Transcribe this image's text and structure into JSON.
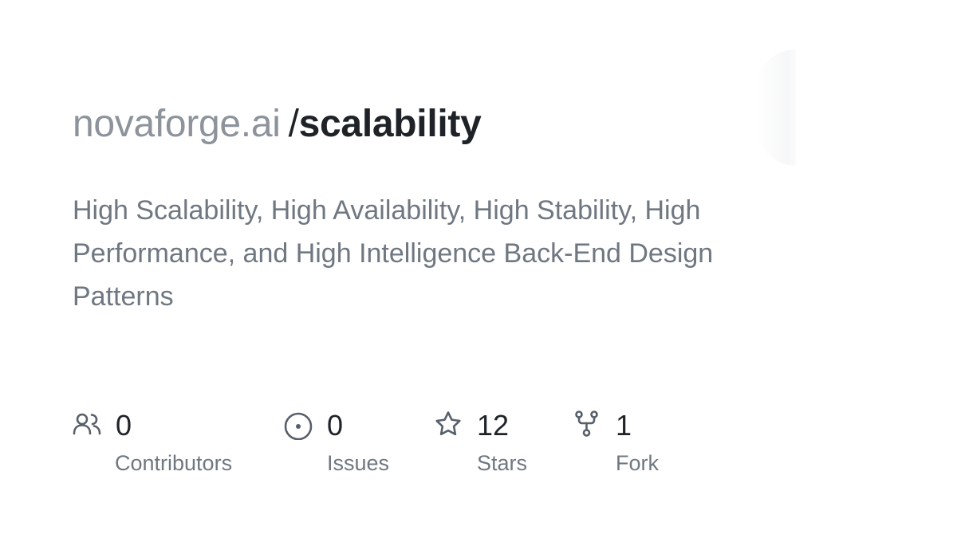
{
  "repo": {
    "owner": "novaforge.ai",
    "slash": "/",
    "name": "scalability",
    "description": "High Scalability, High Availability, High Stability, High Performance, and High Intelligence Back-End Design Patterns"
  },
  "stats": {
    "contributors": {
      "value": "0",
      "label": "Contributors",
      "icon": "people-icon"
    },
    "issues": {
      "value": "0",
      "label": "Issues",
      "icon": "issue-opened-icon"
    },
    "stars": {
      "value": "12",
      "label": "Stars",
      "icon": "star-icon"
    },
    "forks": {
      "value": "1",
      "label": "Fork",
      "icon": "repo-forked-icon"
    }
  },
  "colors": {
    "owner": "#8c939b",
    "repo_name": "#1f2328",
    "muted_text": "#6f7781",
    "icon": "#57606a"
  }
}
